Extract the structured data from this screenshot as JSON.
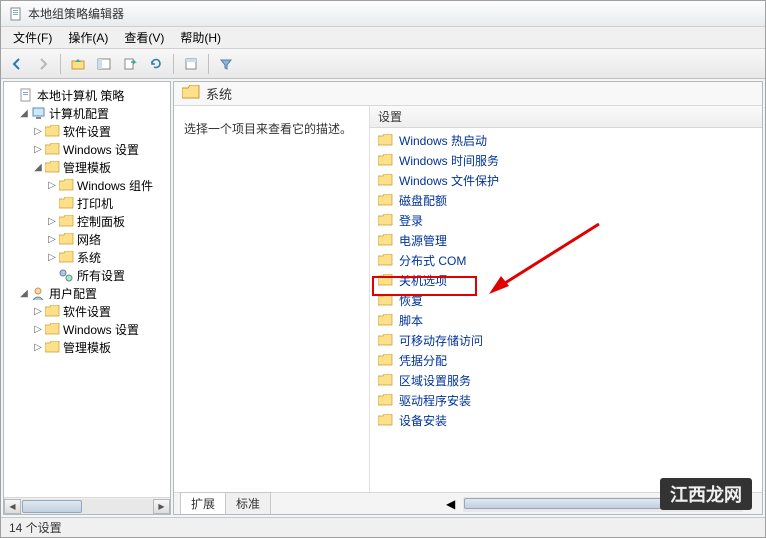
{
  "window": {
    "title": "本地组策略编辑器"
  },
  "menu": {
    "file": "文件(F)",
    "action": "操作(A)",
    "view": "查看(V)",
    "help": "帮助(H)"
  },
  "tree": {
    "root": "本地计算机 策略",
    "computer_config": "计算机配置",
    "software_settings": "软件设置",
    "windows_settings": "Windows 设置",
    "admin_templates": "管理模板",
    "windows_components": "Windows 组件",
    "printers": "打印机",
    "control_panel": "控制面板",
    "network": "网络",
    "system": "系统",
    "all_settings": "所有设置",
    "user_config": "用户配置",
    "user_software_settings": "软件设置",
    "user_windows_settings": "Windows 设置",
    "user_admin_templates": "管理模板"
  },
  "right": {
    "header_title": "系统",
    "description": "选择一个项目来查看它的描述。",
    "column_header": "设置",
    "items": [
      "Windows 热启动",
      "Windows 时间服务",
      "Windows 文件保护",
      "磁盘配额",
      "登录",
      "电源管理",
      "分布式 COM",
      "关机选项",
      "恢复",
      "脚本",
      "可移动存储访问",
      "凭据分配",
      "区域设置服务",
      "驱动程序安装",
      "设备安装"
    ]
  },
  "tabs": {
    "extended": "扩展",
    "standard": "标准"
  },
  "status": "14 个设置",
  "watermark": "江西龙网"
}
